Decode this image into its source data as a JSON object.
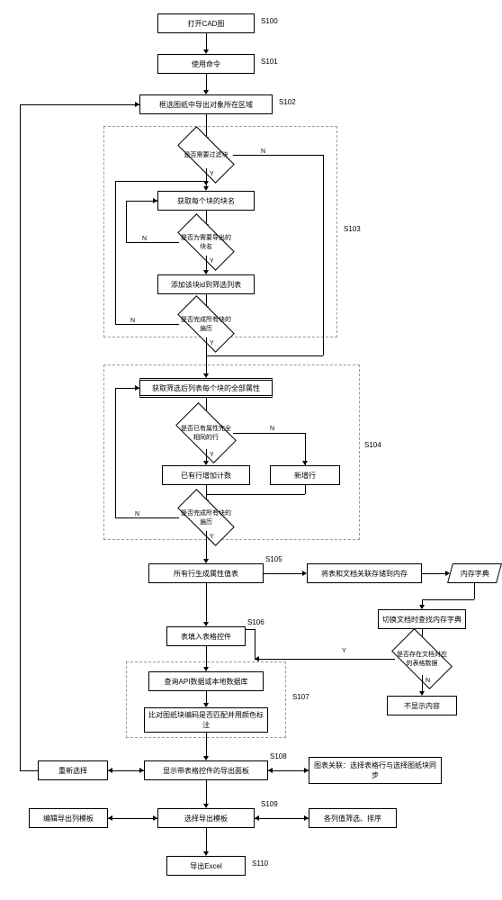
{
  "steps": {
    "s100": {
      "label": "S100",
      "text": "打开CAD图"
    },
    "s101": {
      "label": "S101",
      "text": "使用命令"
    },
    "s102": {
      "label": "S102",
      "text": "框选图纸中导出对象所在区域"
    },
    "s103": {
      "label": "S103"
    },
    "s104": {
      "label": "S104"
    },
    "s105": {
      "label": "S105",
      "text": "所有行生成属性值表"
    },
    "s106": {
      "label": "S106",
      "text": "表填入表格控件"
    },
    "s107": {
      "label": "S107"
    },
    "s108": {
      "label": "S108",
      "text": "显示带表格控件的导出面板"
    },
    "s109": {
      "label": "S109",
      "text": "选择导出模板"
    },
    "s110": {
      "label": "S110",
      "text": "导出Excel"
    }
  },
  "decisions": {
    "d_filter": "是否需要过滤块",
    "d_needexport": "是否为需要导出的块名",
    "d_traverse1": "是否完成所有块的遍历",
    "d_samerow": "是否已有属性完全相同的行",
    "d_traverse2": "是否完成所有块的遍历",
    "d_hasdata": "是否存在文档对应的表格数据"
  },
  "processes": {
    "p_getname": "获取每个块的块名",
    "p_addid": "添加该块id到筛选列表",
    "p_getattrs": "获取筛选后列表每个块的全部属性",
    "p_inccount": "已有行增加计数",
    "p_newrow": "新增行",
    "p_savemem": "将表和文档关联存储到内存",
    "p_memdict": "内存字典",
    "p_switchdoc": "切换文档时查找内存字典",
    "p_nodisplay": "不显示内容",
    "p_queryapi": "查询API数据或本地数据库",
    "p_compare": "比对图纸块编码是否匹配并用颜色标注",
    "p_reselect": "重新选择",
    "p_chartlink": "图表关联：选择表格行与选择图纸块同步",
    "p_edittemplate": "编辑导出列模板",
    "p_colfilter": "各列值筛选、排序"
  },
  "labels": {
    "Y": "Y",
    "N": "N"
  }
}
